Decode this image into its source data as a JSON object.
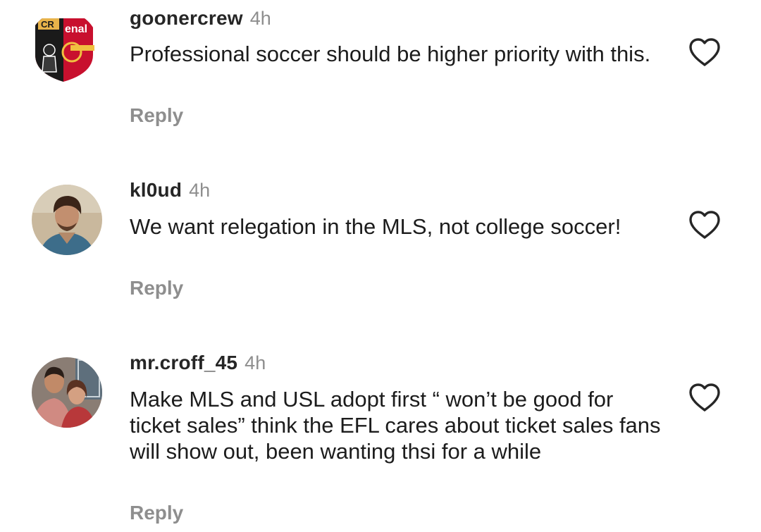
{
  "comments": [
    {
      "username": "goonercrew",
      "time": "4h",
      "text": "Professional soccer should be higher priority with this.",
      "reply_label": "Reply",
      "avatar_icon": "arsenal-crest-avatar"
    },
    {
      "username": "kl0ud",
      "time": "4h",
      "text": "We want relegation in the MLS, not college soccer!",
      "reply_label": "Reply",
      "avatar_icon": "portrait-avatar"
    },
    {
      "username": "mr.croff_45",
      "time": "4h",
      "text": "Make MLS and USL adopt first “ won’t be good for ticket sales” think the EFL cares about ticket sales fans will show out, been wanting thsi for a while",
      "reply_label": "Reply",
      "avatar_icon": "couple-photo-avatar"
    }
  ],
  "like_icon": "heart-outline-icon",
  "colors": {
    "username": "#262626",
    "body_text": "#1c1c1c",
    "secondary_text": "#8e8e8e",
    "heart_stroke": "#262626"
  }
}
